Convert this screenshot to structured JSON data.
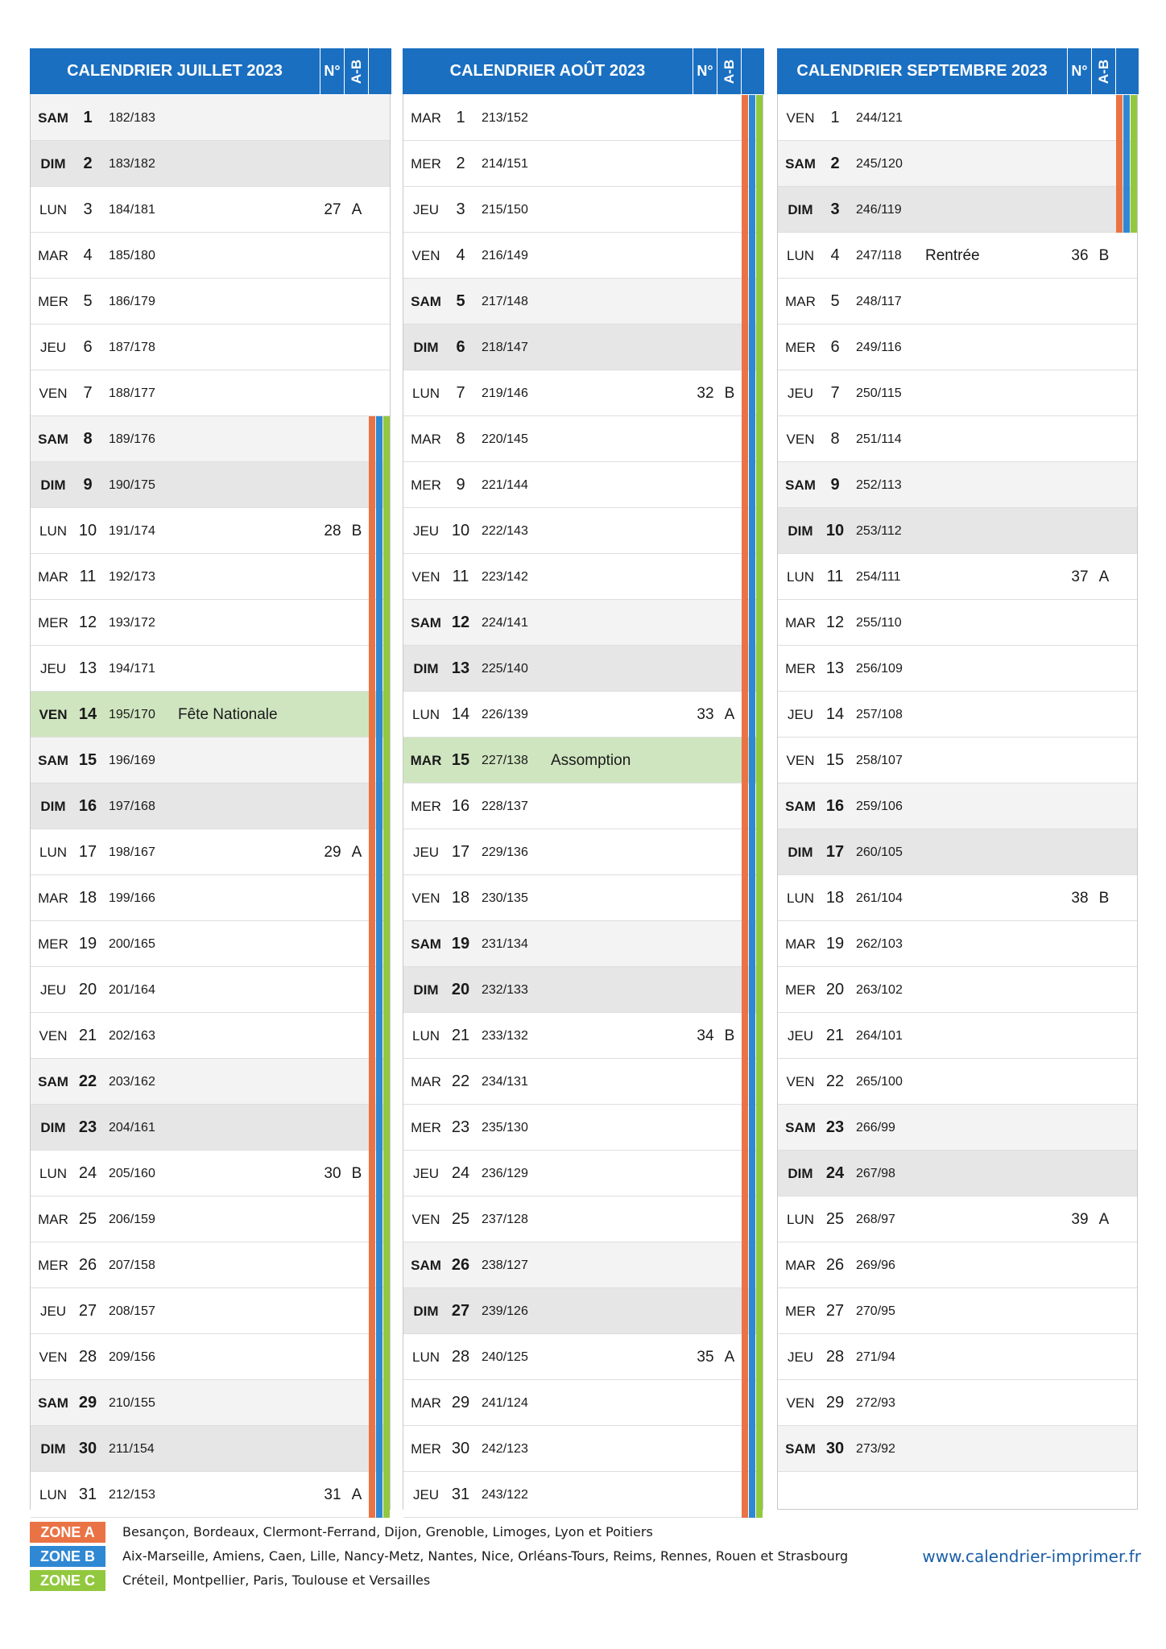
{
  "colors": {
    "header": "#1a6fc1",
    "zone_a": "#ea7345",
    "zone_b": "#2f88d3",
    "zone_c": "#92c83e",
    "holiday": "#cfe5bf",
    "saturday": "#f3f3f3",
    "sunday": "#e6e6e6"
  },
  "months": [
    {
      "title": "CALENDRIER JUILLET 2023",
      "week_col": "N°",
      "ab_col": "A-B",
      "days": [
        {
          "wd": "SAM",
          "d": "1",
          "doy": "182/183",
          "type": "sat",
          "zones": false
        },
        {
          "wd": "DIM",
          "d": "2",
          "doy": "183/182",
          "type": "sun",
          "zones": false
        },
        {
          "wd": "LUN",
          "d": "3",
          "doy": "184/181",
          "week": "27",
          "ab": "A",
          "zones": false
        },
        {
          "wd": "MAR",
          "d": "4",
          "doy": "185/180",
          "zones": false
        },
        {
          "wd": "MER",
          "d": "5",
          "doy": "186/179",
          "zones": false
        },
        {
          "wd": "JEU",
          "d": "6",
          "doy": "187/178",
          "zones": false
        },
        {
          "wd": "VEN",
          "d": "7",
          "doy": "188/177",
          "zones": false
        },
        {
          "wd": "SAM",
          "d": "8",
          "doy": "189/176",
          "type": "sat",
          "zones": true
        },
        {
          "wd": "DIM",
          "d": "9",
          "doy": "190/175",
          "type": "sun",
          "zones": true
        },
        {
          "wd": "LUN",
          "d": "10",
          "doy": "191/174",
          "week": "28",
          "ab": "B",
          "zones": true
        },
        {
          "wd": "MAR",
          "d": "11",
          "doy": "192/173",
          "zones": true
        },
        {
          "wd": "MER",
          "d": "12",
          "doy": "193/172",
          "zones": true
        },
        {
          "wd": "JEU",
          "d": "13",
          "doy": "194/171",
          "zones": true
        },
        {
          "wd": "VEN",
          "d": "14",
          "doy": "195/170",
          "event": "Fête Nationale",
          "type": "holiday",
          "zones": true
        },
        {
          "wd": "SAM",
          "d": "15",
          "doy": "196/169",
          "type": "sat",
          "zones": true
        },
        {
          "wd": "DIM",
          "d": "16",
          "doy": "197/168",
          "type": "sun",
          "zones": true
        },
        {
          "wd": "LUN",
          "d": "17",
          "doy": "198/167",
          "week": "29",
          "ab": "A",
          "zones": true
        },
        {
          "wd": "MAR",
          "d": "18",
          "doy": "199/166",
          "zones": true
        },
        {
          "wd": "MER",
          "d": "19",
          "doy": "200/165",
          "zones": true
        },
        {
          "wd": "JEU",
          "d": "20",
          "doy": "201/164",
          "zones": true
        },
        {
          "wd": "VEN",
          "d": "21",
          "doy": "202/163",
          "zones": true
        },
        {
          "wd": "SAM",
          "d": "22",
          "doy": "203/162",
          "type": "sat",
          "zones": true
        },
        {
          "wd": "DIM",
          "d": "23",
          "doy": "204/161",
          "type": "sun",
          "zones": true
        },
        {
          "wd": "LUN",
          "d": "24",
          "doy": "205/160",
          "week": "30",
          "ab": "B",
          "zones": true
        },
        {
          "wd": "MAR",
          "d": "25",
          "doy": "206/159",
          "zones": true
        },
        {
          "wd": "MER",
          "d": "26",
          "doy": "207/158",
          "zones": true
        },
        {
          "wd": "JEU",
          "d": "27",
          "doy": "208/157",
          "zones": true
        },
        {
          "wd": "VEN",
          "d": "28",
          "doy": "209/156",
          "zones": true
        },
        {
          "wd": "SAM",
          "d": "29",
          "doy": "210/155",
          "type": "sat",
          "zones": true
        },
        {
          "wd": "DIM",
          "d": "30",
          "doy": "211/154",
          "type": "sun",
          "zones": true
        },
        {
          "wd": "LUN",
          "d": "31",
          "doy": "212/153",
          "week": "31",
          "ab": "A",
          "zones": true
        }
      ]
    },
    {
      "title": "CALENDRIER AOÛT 2023",
      "week_col": "N°",
      "ab_col": "A-B",
      "days": [
        {
          "wd": "MAR",
          "d": "1",
          "doy": "213/152",
          "zones": true
        },
        {
          "wd": "MER",
          "d": "2",
          "doy": "214/151",
          "zones": true
        },
        {
          "wd": "JEU",
          "d": "3",
          "doy": "215/150",
          "zones": true
        },
        {
          "wd": "VEN",
          "d": "4",
          "doy": "216/149",
          "zones": true
        },
        {
          "wd": "SAM",
          "d": "5",
          "doy": "217/148",
          "type": "sat",
          "zones": true
        },
        {
          "wd": "DIM",
          "d": "6",
          "doy": "218/147",
          "type": "sun",
          "zones": true
        },
        {
          "wd": "LUN",
          "d": "7",
          "doy": "219/146",
          "week": "32",
          "ab": "B",
          "zones": true
        },
        {
          "wd": "MAR",
          "d": "8",
          "doy": "220/145",
          "zones": true
        },
        {
          "wd": "MER",
          "d": "9",
          "doy": "221/144",
          "zones": true
        },
        {
          "wd": "JEU",
          "d": "10",
          "doy": "222/143",
          "zones": true
        },
        {
          "wd": "VEN",
          "d": "11",
          "doy": "223/142",
          "zones": true
        },
        {
          "wd": "SAM",
          "d": "12",
          "doy": "224/141",
          "type": "sat",
          "zones": true
        },
        {
          "wd": "DIM",
          "d": "13",
          "doy": "225/140",
          "type": "sun",
          "zones": true
        },
        {
          "wd": "LUN",
          "d": "14",
          "doy": "226/139",
          "week": "33",
          "ab": "A",
          "zones": true
        },
        {
          "wd": "MAR",
          "d": "15",
          "doy": "227/138",
          "event": "Assomption",
          "type": "holiday",
          "zones": true
        },
        {
          "wd": "MER",
          "d": "16",
          "doy": "228/137",
          "zones": true
        },
        {
          "wd": "JEU",
          "d": "17",
          "doy": "229/136",
          "zones": true
        },
        {
          "wd": "VEN",
          "d": "18",
          "doy": "230/135",
          "zones": true
        },
        {
          "wd": "SAM",
          "d": "19",
          "doy": "231/134",
          "type": "sat",
          "zones": true
        },
        {
          "wd": "DIM",
          "d": "20",
          "doy": "232/133",
          "type": "sun",
          "zones": true
        },
        {
          "wd": "LUN",
          "d": "21",
          "doy": "233/132",
          "week": "34",
          "ab": "B",
          "zones": true
        },
        {
          "wd": "MAR",
          "d": "22",
          "doy": "234/131",
          "zones": true
        },
        {
          "wd": "MER",
          "d": "23",
          "doy": "235/130",
          "zones": true
        },
        {
          "wd": "JEU",
          "d": "24",
          "doy": "236/129",
          "zones": true
        },
        {
          "wd": "VEN",
          "d": "25",
          "doy": "237/128",
          "zones": true
        },
        {
          "wd": "SAM",
          "d": "26",
          "doy": "238/127",
          "type": "sat",
          "zones": true
        },
        {
          "wd": "DIM",
          "d": "27",
          "doy": "239/126",
          "type": "sun",
          "zones": true
        },
        {
          "wd": "LUN",
          "d": "28",
          "doy": "240/125",
          "week": "35",
          "ab": "A",
          "zones": true
        },
        {
          "wd": "MAR",
          "d": "29",
          "doy": "241/124",
          "zones": true
        },
        {
          "wd": "MER",
          "d": "30",
          "doy": "242/123",
          "zones": true
        },
        {
          "wd": "JEU",
          "d": "31",
          "doy": "243/122",
          "zones": true
        }
      ]
    },
    {
      "title": "CALENDRIER SEPTEMBRE 2023",
      "week_col": "N°",
      "ab_col": "A-B",
      "days": [
        {
          "wd": "VEN",
          "d": "1",
          "doy": "244/121",
          "zones": true
        },
        {
          "wd": "SAM",
          "d": "2",
          "doy": "245/120",
          "type": "sat",
          "zones": true
        },
        {
          "wd": "DIM",
          "d": "3",
          "doy": "246/119",
          "type": "sun",
          "zones": true
        },
        {
          "wd": "LUN",
          "d": "4",
          "doy": "247/118",
          "event": "Rentrée",
          "week": "36",
          "ab": "B",
          "zones": false
        },
        {
          "wd": "MAR",
          "d": "5",
          "doy": "248/117",
          "zones": false
        },
        {
          "wd": "MER",
          "d": "6",
          "doy": "249/116",
          "zones": false
        },
        {
          "wd": "JEU",
          "d": "7",
          "doy": "250/115",
          "zones": false
        },
        {
          "wd": "VEN",
          "d": "8",
          "doy": "251/114",
          "zones": false
        },
        {
          "wd": "SAM",
          "d": "9",
          "doy": "252/113",
          "type": "sat",
          "zones": false
        },
        {
          "wd": "DIM",
          "d": "10",
          "doy": "253/112",
          "type": "sun",
          "zones": false
        },
        {
          "wd": "LUN",
          "d": "11",
          "doy": "254/111",
          "week": "37",
          "ab": "A",
          "zones": false
        },
        {
          "wd": "MAR",
          "d": "12",
          "doy": "255/110",
          "zones": false
        },
        {
          "wd": "MER",
          "d": "13",
          "doy": "256/109",
          "zones": false
        },
        {
          "wd": "JEU",
          "d": "14",
          "doy": "257/108",
          "zones": false
        },
        {
          "wd": "VEN",
          "d": "15",
          "doy": "258/107",
          "zones": false
        },
        {
          "wd": "SAM",
          "d": "16",
          "doy": "259/106",
          "type": "sat",
          "zones": false
        },
        {
          "wd": "DIM",
          "d": "17",
          "doy": "260/105",
          "type": "sun",
          "zones": false
        },
        {
          "wd": "LUN",
          "d": "18",
          "doy": "261/104",
          "week": "38",
          "ab": "B",
          "zones": false
        },
        {
          "wd": "MAR",
          "d": "19",
          "doy": "262/103",
          "zones": false
        },
        {
          "wd": "MER",
          "d": "20",
          "doy": "263/102",
          "zones": false
        },
        {
          "wd": "JEU",
          "d": "21",
          "doy": "264/101",
          "zones": false
        },
        {
          "wd": "VEN",
          "d": "22",
          "doy": "265/100",
          "zones": false
        },
        {
          "wd": "SAM",
          "d": "23",
          "doy": "266/99",
          "type": "sat",
          "zones": false
        },
        {
          "wd": "DIM",
          "d": "24",
          "doy": "267/98",
          "type": "sun",
          "zones": false
        },
        {
          "wd": "LUN",
          "d": "25",
          "doy": "268/97",
          "week": "39",
          "ab": "A",
          "zones": false
        },
        {
          "wd": "MAR",
          "d": "26",
          "doy": "269/96",
          "zones": false
        },
        {
          "wd": "MER",
          "d": "27",
          "doy": "270/95",
          "zones": false
        },
        {
          "wd": "JEU",
          "d": "28",
          "doy": "271/94",
          "zones": false
        },
        {
          "wd": "VEN",
          "d": "29",
          "doy": "272/93",
          "zones": false
        },
        {
          "wd": "SAM",
          "d": "30",
          "doy": "273/92",
          "type": "sat",
          "zones": false
        }
      ]
    }
  ],
  "legend": {
    "zones": [
      {
        "label": "ZONE A",
        "color": "#ea7345",
        "text": "Besançon, Bordeaux, Clermont-Ferrand, Dijon, Grenoble, Limoges, Lyon et Poitiers"
      },
      {
        "label": "ZONE B",
        "color": "#2f88d3",
        "text": "Aix-Marseille, Amiens, Caen, Lille, Nancy-Metz, Nantes, Nice, Orléans-Tours, Reims, Rennes, Rouen et Strasbourg"
      },
      {
        "label": "ZONE C",
        "color": "#92c83e",
        "text": "Créteil, Montpellier, Paris, Toulouse et Versailles"
      }
    ],
    "website": "www.calendrier-imprimer.fr"
  }
}
